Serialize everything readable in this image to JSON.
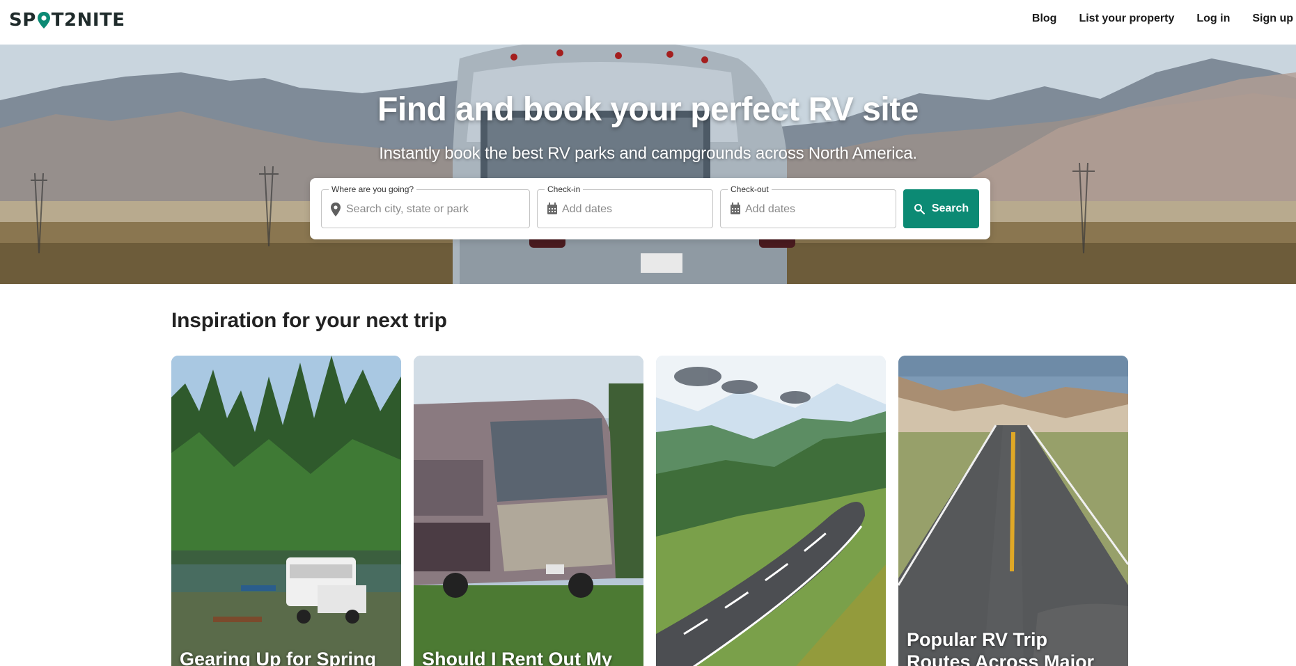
{
  "brand": {
    "logo_text_left": "SP",
    "logo_text_right": "T2NITE",
    "accent_color": "#0c8a74"
  },
  "nav": {
    "blog": "Blog",
    "list_property": "List your property",
    "login": "Log in",
    "signup": "Sign up"
  },
  "hero": {
    "title": "Find and book your perfect RV site",
    "subtitle": "Instantly book the best RV parks and campgrounds across North America."
  },
  "search": {
    "where_label": "Where are you going?",
    "where_placeholder": "Search city, state or park",
    "checkin_label": "Check-in",
    "checkin_placeholder": "Add dates",
    "checkout_label": "Check-out",
    "checkout_placeholder": "Add dates",
    "button_label": "Search"
  },
  "inspiration": {
    "title": "Inspiration for your next trip",
    "cards": [
      {
        "title": "Gearing Up for Spring"
      },
      {
        "title": "Should I Rent Out My"
      },
      {
        "title": ""
      },
      {
        "title": "Popular RV Trip Routes Across Major US"
      }
    ]
  }
}
